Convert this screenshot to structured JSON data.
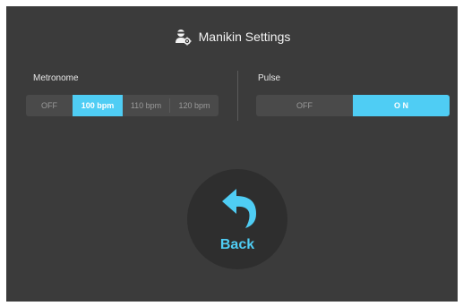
{
  "header": {
    "title": "Manikin Settings",
    "icon": "manikin-settings-icon"
  },
  "metronome": {
    "label": "Metronome",
    "options": [
      "OFF",
      "100 bpm",
      "110 bpm",
      "120 bpm"
    ],
    "selected": "100 bpm"
  },
  "pulse": {
    "label": "Pulse",
    "options": [
      "OFF",
      "O N"
    ],
    "selected": "O N"
  },
  "back": {
    "label": "Back",
    "icon": "back-arrow-icon"
  },
  "colors": {
    "accent": "#4fcdf4",
    "background": "#3b3b3b",
    "button_bg": "#2e2e2e"
  }
}
